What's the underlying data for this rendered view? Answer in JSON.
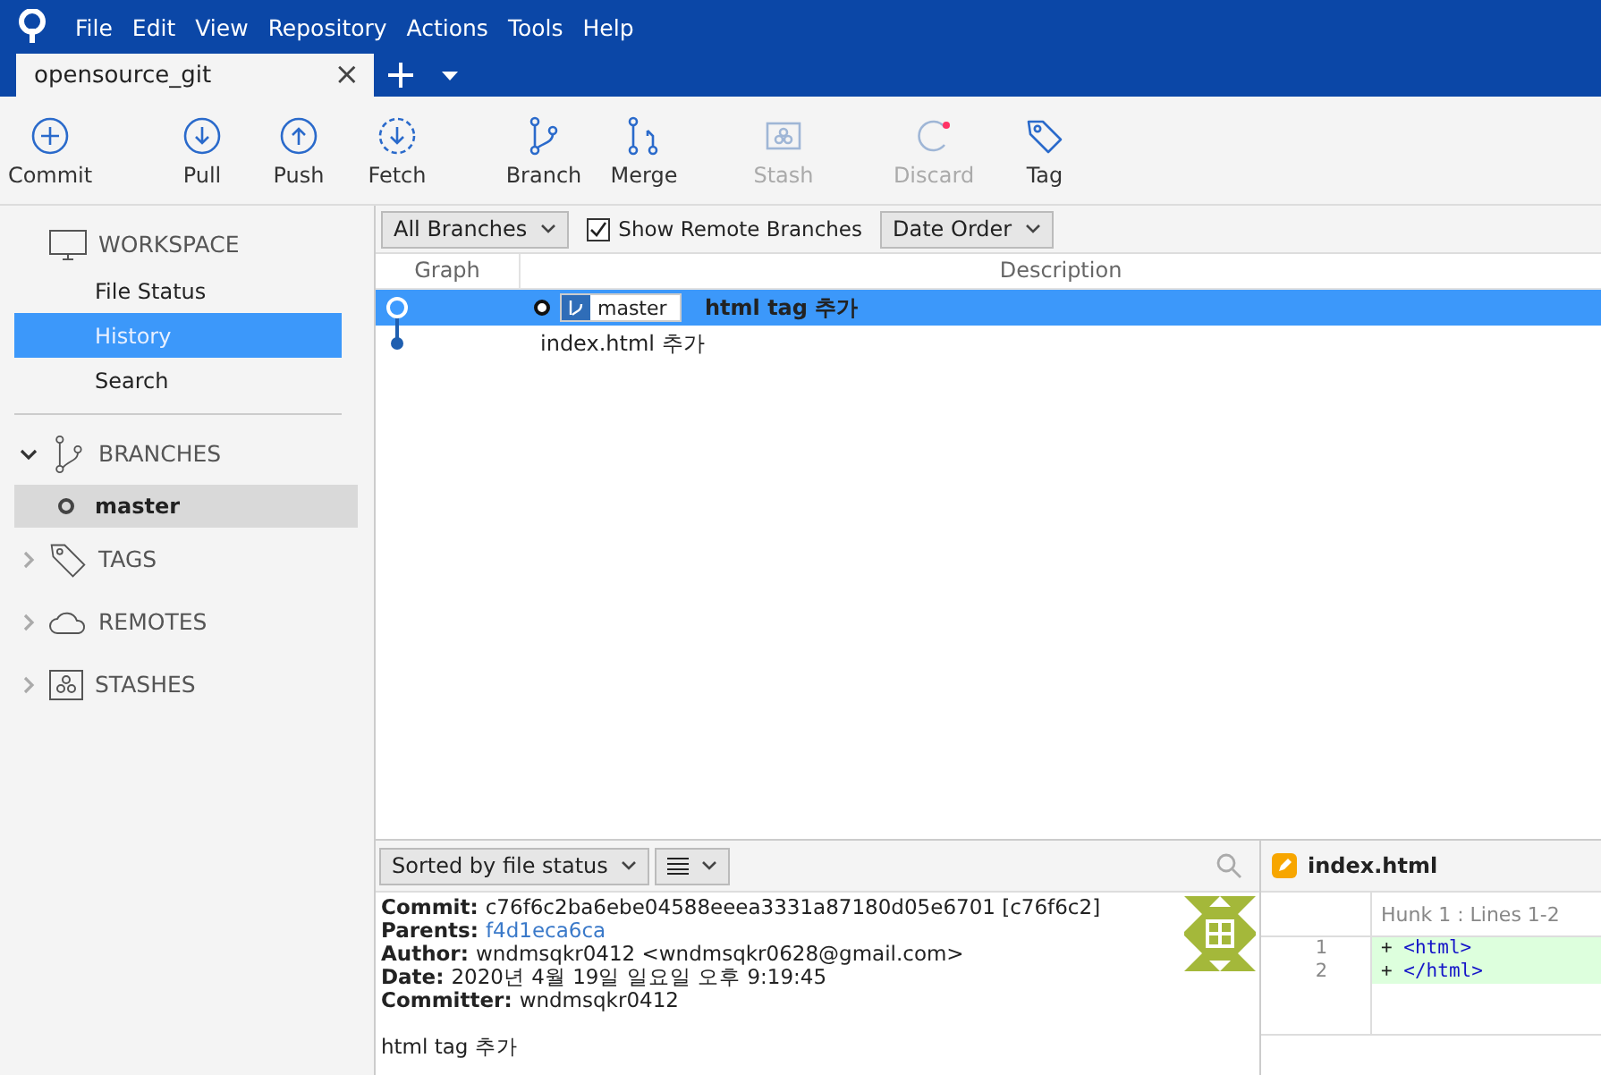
{
  "menu": [
    "File",
    "Edit",
    "View",
    "Repository",
    "Actions",
    "Tools",
    "Help"
  ],
  "tabs": [
    {
      "label": "opensource_git",
      "selected": true,
      "close": "×"
    }
  ],
  "toolbar": [
    {
      "label": "Commit",
      "disabled": false
    },
    {
      "label": "Pull",
      "disabled": false
    },
    {
      "label": "Push",
      "disabled": false
    },
    {
      "label": "Fetch",
      "disabled": false
    },
    {
      "label": "Branch",
      "disabled": false
    },
    {
      "label": "Merge",
      "disabled": false
    },
    {
      "label": "Stash",
      "disabled": true
    },
    {
      "label": "Discard",
      "disabled": true
    },
    {
      "label": "Tag",
      "disabled": false
    }
  ],
  "sidebar": {
    "sections": [
      {
        "title": "WORKSPACE",
        "kind": "workspace",
        "items": [
          {
            "label": "File Status",
            "selected": false
          },
          {
            "label": "History",
            "selected": true
          },
          {
            "label": "Search",
            "selected": false
          }
        ]
      },
      {
        "title": "BRANCHES",
        "kind": "branches",
        "expanded": true,
        "items": [
          {
            "label": "master",
            "selected": true
          }
        ]
      },
      {
        "title": "TAGS",
        "kind": "tags",
        "expanded": false
      },
      {
        "title": "REMOTES",
        "kind": "remotes",
        "expanded": false
      },
      {
        "title": "STASHES",
        "kind": "stashes",
        "expanded": false
      }
    ]
  },
  "filters": {
    "branches": "All Branches",
    "show_remote": {
      "label": "Show Remote Branches",
      "checked": true
    },
    "order": "Date Order"
  },
  "table": {
    "columns": [
      "Graph",
      "Description"
    ],
    "rows": [
      {
        "head": true,
        "branch": "master",
        "message": "html tag 추가",
        "selected": true
      },
      {
        "head": false,
        "message": "index.html 추가",
        "selected": false
      }
    ]
  },
  "files_bar": {
    "sort": "Sorted by file status"
  },
  "details": {
    "fields": [
      {
        "label": "Commit:",
        "value": "c76f6c2ba6ebe04588eeea3331a87180d05e6701 [c76f6c2]",
        "link": false
      },
      {
        "label": "Parents:",
        "value": "f4d1eca6ca",
        "link": true
      },
      {
        "label": "Author:",
        "value": "wndmsqkr0412 <wndmsqkr0628@gmail.com>",
        "link": false
      },
      {
        "label": "Date:",
        "value": "2020년 4월 19일 일요일 오후 9:19:45",
        "link": false
      },
      {
        "label": "Committer:",
        "value": "wndmsqkr0412",
        "link": false
      }
    ],
    "message": "html tag 추가"
  },
  "diff": {
    "file": "index.html",
    "hunk": "Hunk 1 : Lines 1-2",
    "lines": [
      {
        "number": "1",
        "marker": "+",
        "code": "<html>"
      },
      {
        "number": "2",
        "marker": "+",
        "code": "</html>"
      }
    ]
  }
}
